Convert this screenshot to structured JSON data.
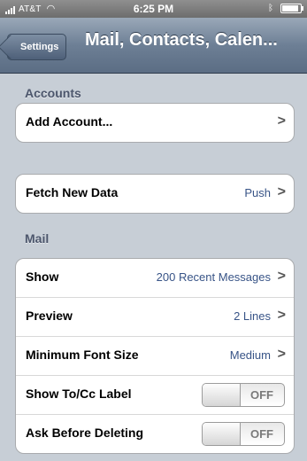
{
  "status_bar": {
    "carrier": "AT&T",
    "time": "6:25 PM"
  },
  "nav": {
    "back_label": "Settings",
    "title": "Mail, Contacts, Calen..."
  },
  "sections": {
    "accounts_header": "Accounts",
    "mail_header": "Mail"
  },
  "accounts": {
    "add_account_label": "Add Account...",
    "chevron": ">"
  },
  "fetch": {
    "label": "Fetch New Data",
    "value": "Push",
    "chevron": ">"
  },
  "mail_settings": [
    {
      "label": "Show",
      "value": "200 Recent Messages",
      "chevron": ">"
    },
    {
      "label": "Preview",
      "value": "2 Lines",
      "chevron": ">"
    },
    {
      "label": "Minimum Font Size",
      "value": "Medium",
      "chevron": ">"
    },
    {
      "label": "Show To/Cc Label",
      "toggle": "OFF"
    },
    {
      "label": "Ask Before Deleting",
      "toggle": "OFF"
    }
  ]
}
